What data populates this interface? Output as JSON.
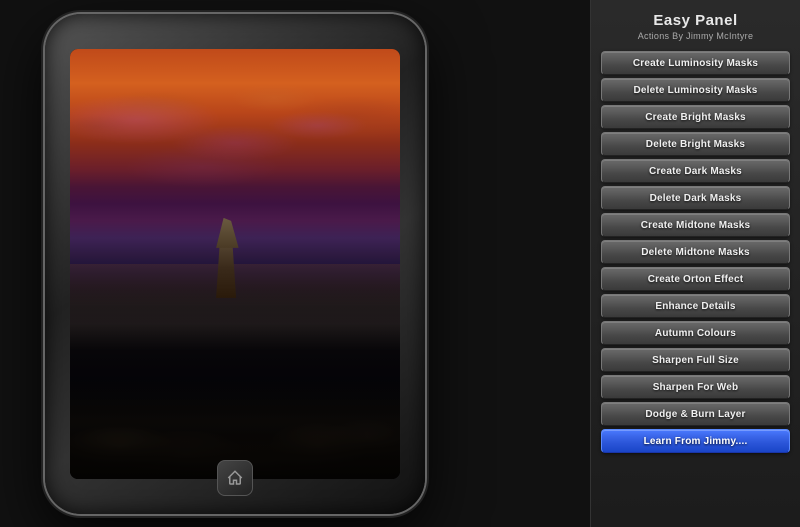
{
  "panel": {
    "title": "Easy Panel",
    "subtitle": "Actions By Jimmy McIntyre",
    "buttons": [
      {
        "id": "create-luminosity-masks",
        "label": "Create Luminosity Masks",
        "highlight": false
      },
      {
        "id": "delete-luminosity-masks",
        "label": "Delete Luminosity Masks",
        "highlight": false
      },
      {
        "id": "create-bright-masks",
        "label": "Create Bright Masks",
        "highlight": false
      },
      {
        "id": "delete-bright-masks",
        "label": "Delete Bright Masks",
        "highlight": false
      },
      {
        "id": "create-dark-masks",
        "label": "Create Dark Masks",
        "highlight": false
      },
      {
        "id": "delete-dark-masks",
        "label": "Delete Dark Masks",
        "highlight": false
      },
      {
        "id": "create-midtone-masks",
        "label": "Create Midtone Masks",
        "highlight": false
      },
      {
        "id": "delete-midtone-masks",
        "label": "Delete Midtone Masks",
        "highlight": false
      },
      {
        "id": "create-orton-effect",
        "label": "Create Orton Effect",
        "highlight": false
      },
      {
        "id": "enhance-details",
        "label": "Enhance Details",
        "highlight": false
      },
      {
        "id": "autumn-colours",
        "label": "Autumn Colours",
        "highlight": false
      },
      {
        "id": "sharpen-full-size",
        "label": "Sharpen Full Size",
        "highlight": false
      },
      {
        "id": "sharpen-for-web",
        "label": "Sharpen For Web",
        "highlight": false
      },
      {
        "id": "dodge-burn-layer",
        "label": "Dodge & Burn Layer",
        "highlight": false
      },
      {
        "id": "learn-from-jimmy",
        "label": "Learn From Jimmy....",
        "highlight": true
      }
    ]
  },
  "ipad": {
    "home_button_label": "⌂"
  }
}
